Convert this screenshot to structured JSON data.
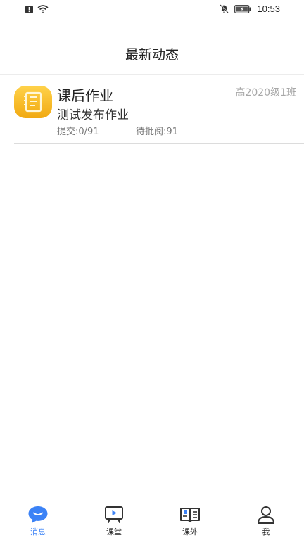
{
  "status": {
    "time": "10:53"
  },
  "header": {
    "title": "最新动态"
  },
  "feed": [
    {
      "title": "课后作业",
      "class_name": "高2020级1班",
      "subtitle": "测试发布作业",
      "submit_stat": "提交:0/91",
      "review_stat": "待批阅:91"
    }
  ],
  "tabs": [
    {
      "label": "消息",
      "icon": "message-icon",
      "active": true
    },
    {
      "label": "课堂",
      "icon": "classroom-icon",
      "active": false
    },
    {
      "label": "课外",
      "icon": "book-icon",
      "active": false
    },
    {
      "label": "我",
      "icon": "user-icon",
      "active": false
    }
  ],
  "colors": {
    "accent": "#3b82f6",
    "icon_yellow": "#f5b921"
  }
}
